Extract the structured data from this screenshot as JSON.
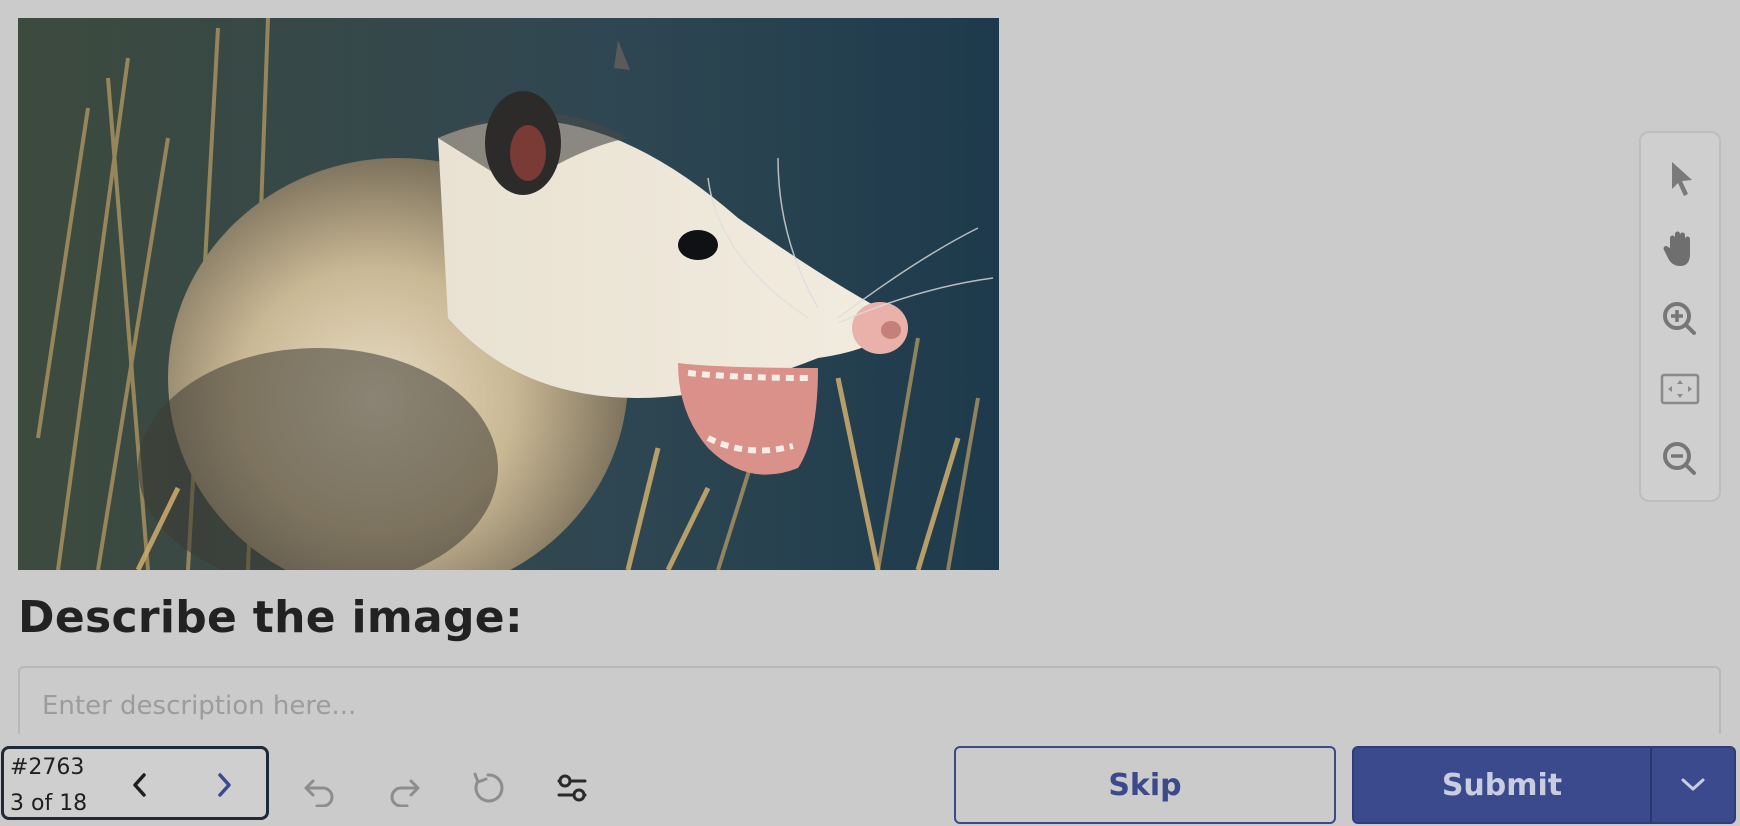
{
  "tools": {
    "select": "cursor-icon",
    "pan": "hand-icon",
    "zoom_in": "zoom-in-icon",
    "fit": "fit-screen-icon",
    "zoom_out": "zoom-out-icon"
  },
  "prompt": {
    "title": "Describe the image:"
  },
  "description": {
    "placeholder": "Enter description here...",
    "value": ""
  },
  "navigation": {
    "task_id": "#2763",
    "position": "3 of 18"
  },
  "actions": {
    "skip_label": "Skip",
    "submit_label": "Submit"
  },
  "colors": {
    "background": "#cbcbcb",
    "accent": "#3b4a8d",
    "submit_text": "#c9cde0"
  }
}
